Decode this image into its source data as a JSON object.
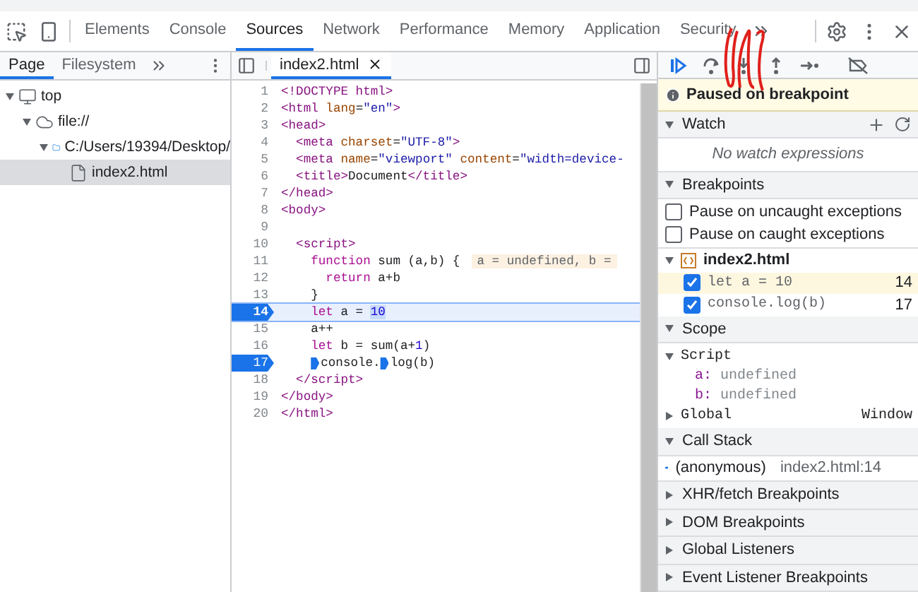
{
  "top_tabs": [
    {
      "label": "Elements",
      "selected": false
    },
    {
      "label": "Console",
      "selected": false
    },
    {
      "label": "Sources",
      "selected": true
    },
    {
      "label": "Network",
      "selected": false
    },
    {
      "label": "Performance",
      "selected": false
    },
    {
      "label": "Memory",
      "selected": false
    },
    {
      "label": "Application",
      "selected": false
    },
    {
      "label": "Security",
      "selected": false
    }
  ],
  "navigator": {
    "tabs": [
      {
        "label": "Page",
        "selected": true
      },
      {
        "label": "Filesystem",
        "selected": false
      }
    ],
    "tree": [
      {
        "label": "top",
        "kind": "frame",
        "expanded": true,
        "selected": false,
        "children": [
          {
            "label": "file://",
            "kind": "origin",
            "expanded": true,
            "selected": false,
            "children": [
              {
                "label": "C:/Users/19394/Desktop/",
                "kind": "folder",
                "expanded": true,
                "selected": false,
                "children": [
                  {
                    "label": "index2.html",
                    "kind": "file",
                    "selected": true
                  }
                ]
              }
            ]
          }
        ]
      }
    ]
  },
  "editor": {
    "tabs": [
      {
        "label": "index2.html",
        "selected": true
      }
    ],
    "lines": [
      {
        "number": "1",
        "breakpoint": false,
        "paused": false,
        "tokens": [
          {
            "text": "<!DOCTYPE html>",
            "kind": "tag"
          }
        ]
      },
      {
        "number": "2",
        "breakpoint": false,
        "paused": false,
        "tokens": [
          {
            "text": "<html",
            "kind": "tag"
          },
          {
            "text": " lang",
            "kind": "attr"
          },
          {
            "text": "=",
            "kind": "plain"
          },
          {
            "text": "\"en\"",
            "kind": "value"
          },
          {
            "text": ">",
            "kind": "tag"
          }
        ]
      },
      {
        "number": "3",
        "breakpoint": false,
        "paused": false,
        "tokens": [
          {
            "text": "<head>",
            "kind": "tag"
          }
        ]
      },
      {
        "number": "4",
        "breakpoint": false,
        "paused": false,
        "tokens": [
          {
            "text": "  <meta",
            "kind": "tag"
          },
          {
            "text": " charset",
            "kind": "attr"
          },
          {
            "text": "=",
            "kind": "plain"
          },
          {
            "text": "\"UTF-8\"",
            "kind": "value"
          },
          {
            "text": ">",
            "kind": "tag"
          }
        ]
      },
      {
        "number": "5",
        "breakpoint": false,
        "paused": false,
        "tokens": [
          {
            "text": "  <meta",
            "kind": "tag"
          },
          {
            "text": " name",
            "kind": "attr"
          },
          {
            "text": "=",
            "kind": "plain"
          },
          {
            "text": "\"viewport\"",
            "kind": "value"
          },
          {
            "text": " content",
            "kind": "attr"
          },
          {
            "text": "=",
            "kind": "plain"
          },
          {
            "text": "\"width=device-",
            "kind": "value"
          }
        ]
      },
      {
        "number": "6",
        "breakpoint": false,
        "paused": false,
        "tokens": [
          {
            "text": "  <title>",
            "kind": "tag"
          },
          {
            "text": "Document",
            "kind": "plain"
          },
          {
            "text": "</title>",
            "kind": "tag"
          }
        ]
      },
      {
        "number": "7",
        "breakpoint": false,
        "paused": false,
        "tokens": [
          {
            "text": "</head>",
            "kind": "tag"
          }
        ]
      },
      {
        "number": "8",
        "breakpoint": false,
        "paused": false,
        "tokens": [
          {
            "text": "<body>",
            "kind": "tag"
          }
        ]
      },
      {
        "number": "9",
        "breakpoint": false,
        "paused": false
      },
      {
        "number": "10",
        "breakpoint": false,
        "paused": false,
        "tokens": [
          {
            "text": "  <script>",
            "kind": "tag"
          }
        ]
      },
      {
        "number": "11",
        "breakpoint": false,
        "paused": false,
        "tokens": [
          {
            "text": "    function",
            "kind": "keyword"
          },
          {
            "text": " sum (a,b) {",
            "kind": "plain"
          },
          {
            "text": "a = undefined, b =",
            "kind": "inline-value"
          }
        ]
      },
      {
        "number": "12",
        "breakpoint": false,
        "paused": false,
        "tokens": [
          {
            "text": "      return",
            "kind": "keyword"
          },
          {
            "text": " a+b",
            "kind": "plain"
          }
        ]
      },
      {
        "number": "13",
        "breakpoint": false,
        "paused": false,
        "tokens": [
          {
            "text": "    }",
            "kind": "plain"
          }
        ]
      },
      {
        "number": "14",
        "breakpoint": true,
        "paused": true,
        "tokens": [
          {
            "text": "    let",
            "kind": "keyword"
          },
          {
            "text": " a = ",
            "kind": "plain"
          },
          {
            "text": "10",
            "kind": "current"
          }
        ]
      },
      {
        "number": "15",
        "breakpoint": false,
        "paused": false,
        "tokens": [
          {
            "text": "    a++",
            "kind": "plain"
          }
        ]
      },
      {
        "number": "16",
        "breakpoint": false,
        "paused": false,
        "tokens": [
          {
            "text": "    let",
            "kind": "keyword"
          },
          {
            "text": " b = sum(a+",
            "kind": "plain"
          },
          {
            "text": "1",
            "kind": "number"
          },
          {
            "text": ")",
            "kind": "plain"
          }
        ]
      },
      {
        "number": "17",
        "breakpoint": true,
        "paused": false,
        "tokens": [
          {
            "kind": "marker"
          },
          {
            "text": "console.",
            "kind": "plain"
          },
          {
            "kind": "marker"
          },
          {
            "text": "log(b)",
            "kind": "plain"
          }
        ]
      },
      {
        "number": "18",
        "breakpoint": false,
        "paused": false,
        "tokens": [
          {
            "text": "  </script>",
            "kind": "tag"
          }
        ]
      },
      {
        "number": "19",
        "breakpoint": false,
        "paused": false,
        "tokens": [
          {
            "text": "</body>",
            "kind": "tag"
          }
        ]
      },
      {
        "number": "20",
        "breakpoint": false,
        "paused": false,
        "tokens": [
          {
            "text": "</html>",
            "kind": "tag"
          }
        ]
      }
    ]
  },
  "debugger": {
    "banner": "Paused on breakpoint",
    "sections": [
      {
        "kind": "watch",
        "title": "Watch",
        "expanded": true,
        "empty_text": "No watch expressions"
      },
      {
        "kind": "breakpoints",
        "title": "Breakpoints",
        "expanded": true,
        "options": [
          {
            "label": "Pause on uncaught exceptions",
            "checked": false
          },
          {
            "label": "Pause on caught exceptions",
            "checked": false
          }
        ],
        "files": [
          {
            "name": "index2.html",
            "expanded": true,
            "items": [
              {
                "code": "let a = 10",
                "line": "14",
                "checked": true,
                "selected": true
              },
              {
                "code": "console.log(b)",
                "line": "17",
                "checked": true,
                "selected": false
              }
            ]
          }
        ]
      },
      {
        "kind": "scope",
        "title": "Scope",
        "expanded": true,
        "groups": [
          {
            "name": "Script",
            "expanded": true,
            "vars": [
              {
                "name": "a:",
                "value": "undefined"
              },
              {
                "name": "b:",
                "value": "undefined"
              }
            ]
          },
          {
            "name": "Global",
            "expanded": false,
            "value": "Window"
          }
        ]
      },
      {
        "kind": "callstack",
        "title": "Call Stack",
        "expanded": true,
        "frames": [
          {
            "name": "(anonymous)",
            "location": "index2.html:14",
            "selected": true
          }
        ]
      },
      {
        "kind": "plain",
        "title": "XHR/fetch Breakpoints",
        "expanded": false
      },
      {
        "kind": "plain",
        "title": "DOM Breakpoints",
        "expanded": false
      },
      {
        "kind": "plain",
        "title": "Global Listeners",
        "expanded": false
      },
      {
        "kind": "plain",
        "title": "Event Listener Breakpoints",
        "expanded": false
      }
    ]
  }
}
